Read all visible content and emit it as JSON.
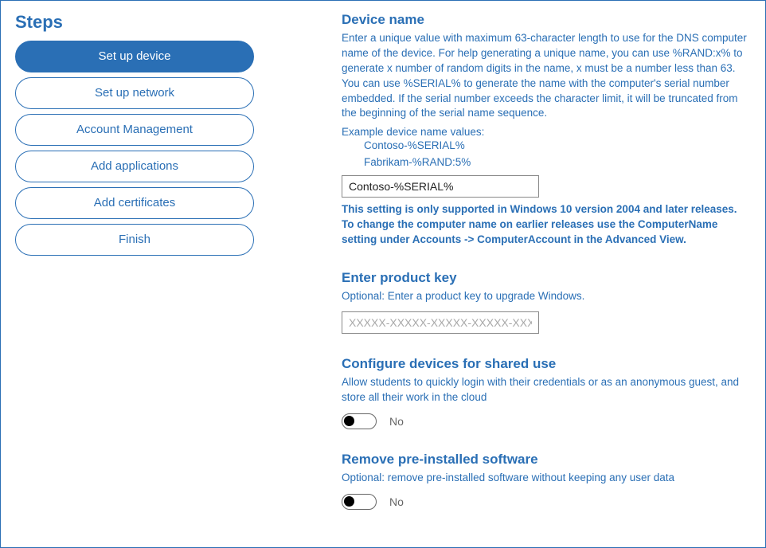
{
  "steps": {
    "title": "Steps",
    "items": [
      {
        "label": "Set up device",
        "active": true
      },
      {
        "label": "Set up network",
        "active": false
      },
      {
        "label": "Account Management",
        "active": false
      },
      {
        "label": "Add applications",
        "active": false
      },
      {
        "label": "Add certificates",
        "active": false
      },
      {
        "label": "Finish",
        "active": false
      }
    ]
  },
  "deviceName": {
    "title": "Device name",
    "description": "Enter a unique value with maximum 63-character length to use for the DNS computer name of the device. For help generating a unique name, you can use %RAND:x% to generate x number of random digits in the name, x must be a number less than 63. You can use %SERIAL% to generate the name with the computer's serial number embedded. If the serial number exceeds the character limit, it will be truncated from the beginning of the serial name sequence.",
    "examplesLabel": "Example device name values:",
    "examples": [
      "Contoso-%SERIAL%",
      "Fabrikam-%RAND:5%"
    ],
    "inputValue": "Contoso-%SERIAL%",
    "note": "This setting is only supported in Windows 10 version 2004 and later releases. To change the computer name on earlier releases use the ComputerName setting under Accounts -> ComputerAccount in the Advanced View."
  },
  "productKey": {
    "title": "Enter product key",
    "description": "Optional: Enter a product key to upgrade Windows.",
    "placeholder": "XXXXX-XXXXX-XXXXX-XXXXX-XXXXX",
    "value": ""
  },
  "sharedUse": {
    "title": "Configure devices for shared use",
    "description": "Allow students to quickly login with their credentials or as an anonymous guest, and store all their work in the cloud",
    "toggleLabel": "No"
  },
  "removeSoftware": {
    "title": "Remove pre-installed software",
    "description": "Optional: remove pre-installed software without keeping any user data",
    "toggleLabel": "No"
  }
}
